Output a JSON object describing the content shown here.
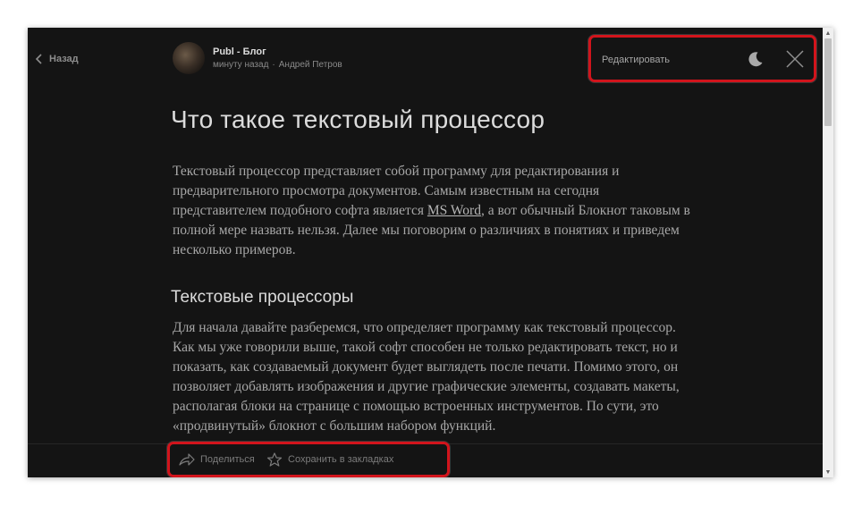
{
  "nav": {
    "back_label": "Назад"
  },
  "post_header": {
    "blog_name": "Publ - Блог",
    "time": "минуту назад",
    "separator": "·",
    "author": "Андрей Петров"
  },
  "top_actions": {
    "edit_label": "Редактировать",
    "theme_icon": "moon-icon",
    "close_icon": "close-icon"
  },
  "article": {
    "title": "Что такое текстовый процессор",
    "p1_before_link": "Текстовый процессор представляет собой программу для редактирования и предварительного просмотра документов. Самым известным на сегодня представителем подобного софта является ",
    "p1_link": "MS Word",
    "p1_after_link": ", а вот обычный Блокнот таковым в полной мере назвать нельзя. Далее мы поговорим о различиях в понятиях и приведем несколько примеров.",
    "h2": "Текстовые процессоры",
    "p2": "Для начала давайте разберемся, что определяет программу как текстовый процессор. Как мы уже говорили выше, такой софт способен не только редактировать текст, но и показать, как создаваемый документ будет выглядеть после печати. Помимо этого, он позволяет добавлять изображения и другие графические элементы, создавать макеты, располагая блоки на странице с помощью встроенных инструментов. По сути, это «продвинутый» блокнот с большим набором функций."
  },
  "bottom_actions": {
    "share_label": "Поделиться",
    "save_label": "Сохранить в закладках"
  },
  "colors": {
    "background": "#141414",
    "highlight": "#d2141c"
  }
}
